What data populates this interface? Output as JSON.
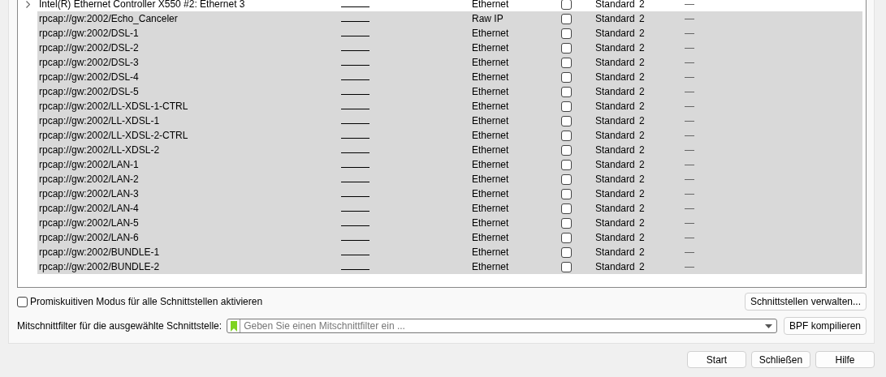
{
  "interfaces": [
    {
      "name": "Intel(R) Ethernet Controller X550 #2: Ethernet 3",
      "expandable": true,
      "selected": false,
      "link_type": "Ethernet",
      "monitor": false,
      "buffer": "Standard",
      "snaplen": "2",
      "filter": "—"
    },
    {
      "name": "rpcap://gw:2002/Echo_Canceler",
      "expandable": false,
      "selected": true,
      "link_type": "Raw IP",
      "monitor": false,
      "buffer": "Standard",
      "snaplen": "2",
      "filter": "—"
    },
    {
      "name": "rpcap://gw:2002/DSL-1",
      "expandable": false,
      "selected": true,
      "link_type": "Ethernet",
      "monitor": false,
      "buffer": "Standard",
      "snaplen": "2",
      "filter": "—"
    },
    {
      "name": "rpcap://gw:2002/DSL-2",
      "expandable": false,
      "selected": true,
      "link_type": "Ethernet",
      "monitor": false,
      "buffer": "Standard",
      "snaplen": "2",
      "filter": "—"
    },
    {
      "name": "rpcap://gw:2002/DSL-3",
      "expandable": false,
      "selected": true,
      "link_type": "Ethernet",
      "monitor": false,
      "buffer": "Standard",
      "snaplen": "2",
      "filter": "—"
    },
    {
      "name": "rpcap://gw:2002/DSL-4",
      "expandable": false,
      "selected": true,
      "link_type": "Ethernet",
      "monitor": false,
      "buffer": "Standard",
      "snaplen": "2",
      "filter": "—"
    },
    {
      "name": "rpcap://gw:2002/DSL-5",
      "expandable": false,
      "selected": true,
      "link_type": "Ethernet",
      "monitor": false,
      "buffer": "Standard",
      "snaplen": "2",
      "filter": "—"
    },
    {
      "name": "rpcap://gw:2002/LL-XDSL-1-CTRL",
      "expandable": false,
      "selected": true,
      "link_type": "Ethernet",
      "monitor": false,
      "buffer": "Standard",
      "snaplen": "2",
      "filter": "—"
    },
    {
      "name": "rpcap://gw:2002/LL-XDSL-1",
      "expandable": false,
      "selected": true,
      "link_type": "Ethernet",
      "monitor": false,
      "buffer": "Standard",
      "snaplen": "2",
      "filter": "—"
    },
    {
      "name": "rpcap://gw:2002/LL-XDSL-2-CTRL",
      "expandable": false,
      "selected": true,
      "link_type": "Ethernet",
      "monitor": false,
      "buffer": "Standard",
      "snaplen": "2",
      "filter": "—"
    },
    {
      "name": "rpcap://gw:2002/LL-XDSL-2",
      "expandable": false,
      "selected": true,
      "link_type": "Ethernet",
      "monitor": false,
      "buffer": "Standard",
      "snaplen": "2",
      "filter": "—"
    },
    {
      "name": "rpcap://gw:2002/LAN-1",
      "expandable": false,
      "selected": true,
      "link_type": "Ethernet",
      "monitor": false,
      "buffer": "Standard",
      "snaplen": "2",
      "filter": "—"
    },
    {
      "name": "rpcap://gw:2002/LAN-2",
      "expandable": false,
      "selected": true,
      "link_type": "Ethernet",
      "monitor": false,
      "buffer": "Standard",
      "snaplen": "2",
      "filter": "—"
    },
    {
      "name": "rpcap://gw:2002/LAN-3",
      "expandable": false,
      "selected": true,
      "link_type": "Ethernet",
      "monitor": false,
      "buffer": "Standard",
      "snaplen": "2",
      "filter": "—"
    },
    {
      "name": "rpcap://gw:2002/LAN-4",
      "expandable": false,
      "selected": true,
      "link_type": "Ethernet",
      "monitor": false,
      "buffer": "Standard",
      "snaplen": "2",
      "filter": "—"
    },
    {
      "name": "rpcap://gw:2002/LAN-5",
      "expandable": false,
      "selected": true,
      "link_type": "Ethernet",
      "monitor": false,
      "buffer": "Standard",
      "snaplen": "2",
      "filter": "—"
    },
    {
      "name": "rpcap://gw:2002/LAN-6",
      "expandable": false,
      "selected": true,
      "link_type": "Ethernet",
      "monitor": false,
      "buffer": "Standard",
      "snaplen": "2",
      "filter": "—"
    },
    {
      "name": "rpcap://gw:2002/BUNDLE-1",
      "expandable": false,
      "selected": true,
      "link_type": "Ethernet",
      "monitor": false,
      "buffer": "Standard",
      "snaplen": "2",
      "filter": "—"
    },
    {
      "name": "rpcap://gw:2002/BUNDLE-2",
      "expandable": false,
      "selected": true,
      "link_type": "Ethernet",
      "monitor": false,
      "buffer": "Standard",
      "snaplen": "2",
      "filter": "—"
    }
  ],
  "promiscuous": {
    "label": "Promiskuitiven Modus für alle Schnittstellen aktivieren",
    "checked": false
  },
  "manage_button": "Schnittstellen verwalten...",
  "capture_filter": {
    "label": "Mitschnittfilter für die ausgewählte Schnittstelle:",
    "placeholder": "Geben Sie einen Mitschnittfilter ein ..."
  },
  "compile_button": "BPF kompilieren",
  "buttons": [
    "Start",
    "Schließen",
    "Hilfe"
  ]
}
